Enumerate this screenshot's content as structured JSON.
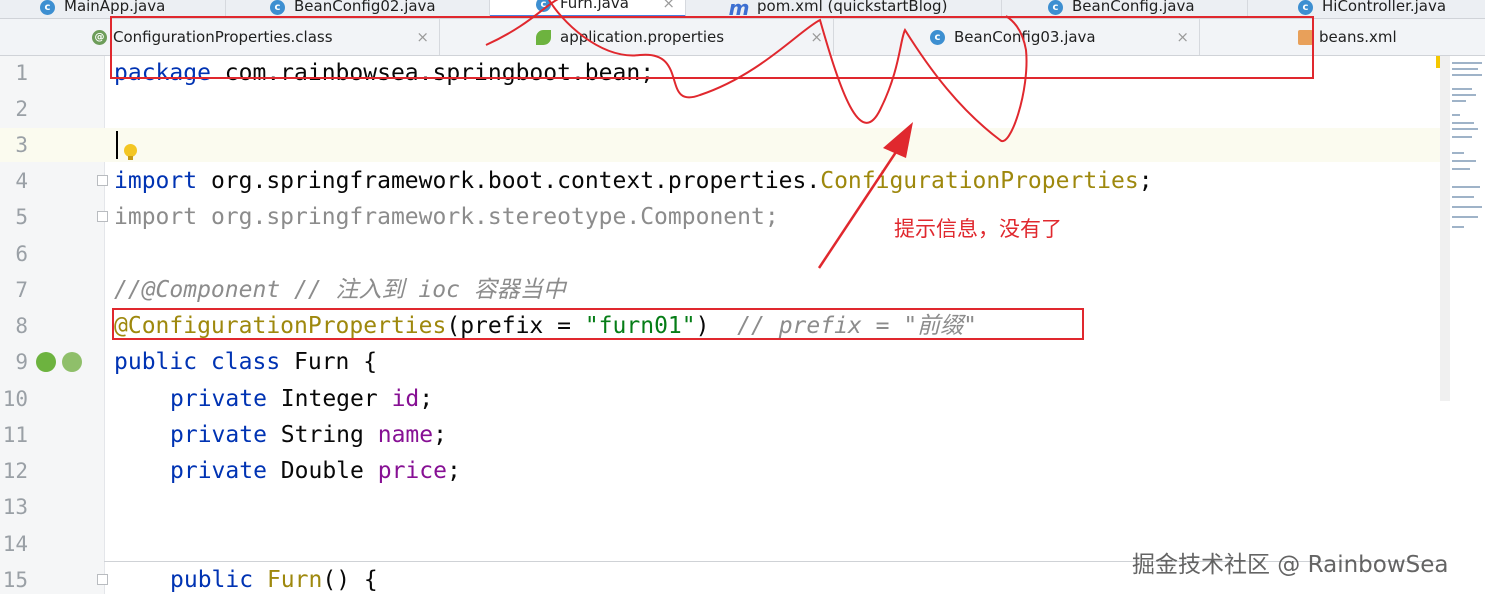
{
  "tabs_row1": [
    {
      "label": "MainApp.java",
      "icon": "c"
    },
    {
      "label": "BeanConfig02.java",
      "icon": "c"
    },
    {
      "label": "Furn.java",
      "icon": "c",
      "active": true
    },
    {
      "label": "pom.xml (quickstartBlog)",
      "icon": "m"
    },
    {
      "label": "BeanConfig.java",
      "icon": "c"
    },
    {
      "label": "HiController.java",
      "icon": "c"
    }
  ],
  "tabs_row2": [
    {
      "label": "ConfigurationProperties.class",
      "icon": "@"
    },
    {
      "label": "application.properties",
      "icon": "leaf"
    },
    {
      "label": "BeanConfig03.java",
      "icon": "c"
    },
    {
      "label": "beans.xml",
      "icon": "xml"
    }
  ],
  "close_glyph": "×",
  "icon_letters": {
    "c": "c",
    "m": "m",
    "at": "@"
  },
  "line_numbers": [
    "1",
    "2",
    "3",
    "4",
    "5",
    "6",
    "7",
    "8",
    "9",
    "10",
    "11",
    "12",
    "13",
    "14",
    "15"
  ],
  "code": {
    "l1_kw": "package",
    "l1_rest": " com.rainbowsea.springboot.bean;",
    "l4_kw": "import",
    "l4_pkg": " org.springframework.boot.context.properties.",
    "l4_cls": "ConfigurationProperties",
    "l4_end": ";",
    "l5_kw": "import",
    "l5_rest": " org.springframework.stereotype.Component;",
    "l7_comment": "//@Component // 注入到 ioc 容器当中",
    "l8_ann": "@ConfigurationProperties",
    "l8_open": "(prefix = ",
    "l8_str": "\"furn01\"",
    "l8_close": ")  ",
    "l8_comment": "// prefix = \"前缀\"",
    "l9_kw": "public class",
    "l9_name": " Furn ",
    "l9_brace": "{",
    "l10_kw": "private",
    "l10_type": " Integer ",
    "l10_field": "id",
    "l11_kw": "private",
    "l11_type": " String ",
    "l11_field": "name",
    "l12_kw": "private",
    "l12_type": " Double ",
    "l12_field": "price",
    "semi": ";",
    "l15_kw": "public",
    "l15_ctor": " Furn",
    "l15_rest": "() {"
  },
  "annotation_note": "提示信息，没有了",
  "watermark": "掘金技术社区 @ RainbowSea",
  "colors": {
    "annotation_red": "#e0282e",
    "keyword": "#0033b3",
    "string": "#067d17",
    "annotation": "#9e880d",
    "field": "#871094",
    "comment": "#8c8c8c"
  }
}
